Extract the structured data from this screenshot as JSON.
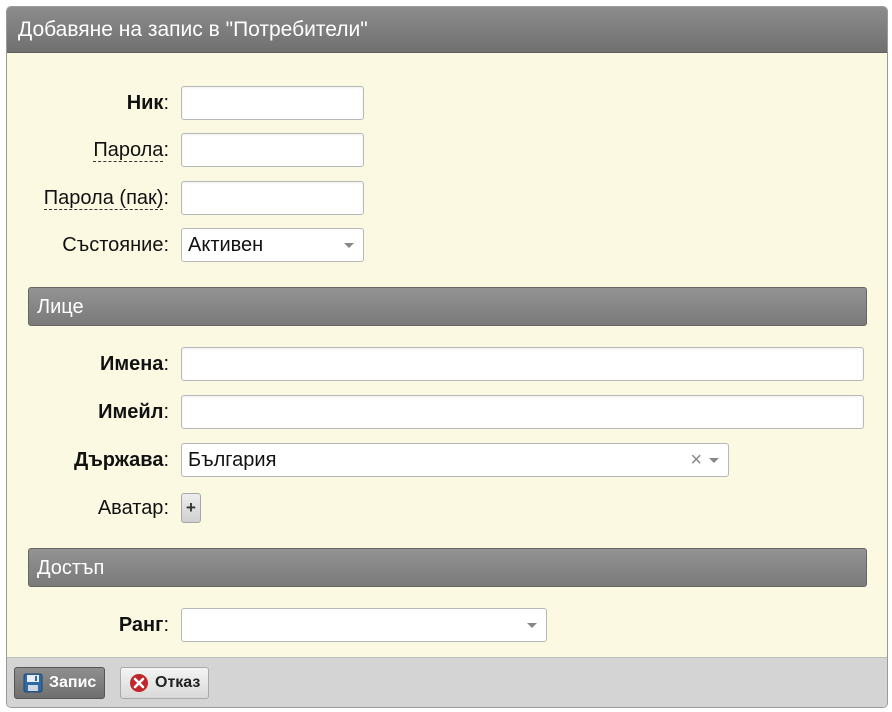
{
  "dialog": {
    "title": "Добавяне на запис в \"Потребители\""
  },
  "fields": {
    "nick": {
      "label": "Ник",
      "value": ""
    },
    "password": {
      "label": "Парола",
      "value": ""
    },
    "password_again": {
      "label": "Парола (пак)",
      "value": ""
    },
    "state": {
      "label": "Състояние",
      "value": "Активен"
    }
  },
  "sections": {
    "person": {
      "title": "Лице",
      "names": {
        "label": "Имена",
        "value": ""
      },
      "email": {
        "label": "Имейл",
        "value": ""
      },
      "country": {
        "label": "Държава",
        "value": "България",
        "clear_glyph": "×"
      },
      "avatar": {
        "label": "Аватар",
        "add_glyph": "+"
      }
    },
    "access": {
      "title": "Достъп",
      "rank": {
        "label": "Ранг",
        "value": ""
      }
    }
  },
  "colon": ":",
  "footer": {
    "save_label": "Запис",
    "cancel_label": "Отказ"
  },
  "icons": {
    "save": "floppy-disk-icon",
    "cancel": "cancel-x-icon"
  },
  "colors": {
    "titlebar": "#7d7d7d",
    "form_bg": "#fbf9e2",
    "cancel_icon": "#c0272d"
  }
}
